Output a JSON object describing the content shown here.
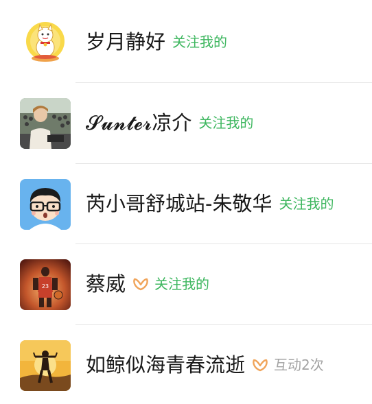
{
  "contacts": [
    {
      "name": "岁月静好",
      "relation": "关注我的",
      "has_badge": false,
      "relation_color": "#3fb760"
    },
    {
      "name": "𝓢𝓾𝓷𝓽𝓮𝓻凉介",
      "relation": "关注我的",
      "has_badge": false,
      "relation_color": "#3fb760"
    },
    {
      "name": "芮小哥舒城站-朱敬华",
      "relation": "关注我的",
      "has_badge": false,
      "relation_color": "#3fb760"
    },
    {
      "name": "蔡威",
      "relation": "关注我的",
      "has_badge": true,
      "badge_icon": "heart-pulse-icon",
      "badge_color": "#f0a45a",
      "relation_color": "#3fb760"
    },
    {
      "name": "如鲸似海青春流逝",
      "relation": "互动2次",
      "has_badge": true,
      "badge_icon": "heart-pulse-icon",
      "badge_color": "#f0a45a",
      "relation_color": "#a3a3a3"
    }
  ]
}
